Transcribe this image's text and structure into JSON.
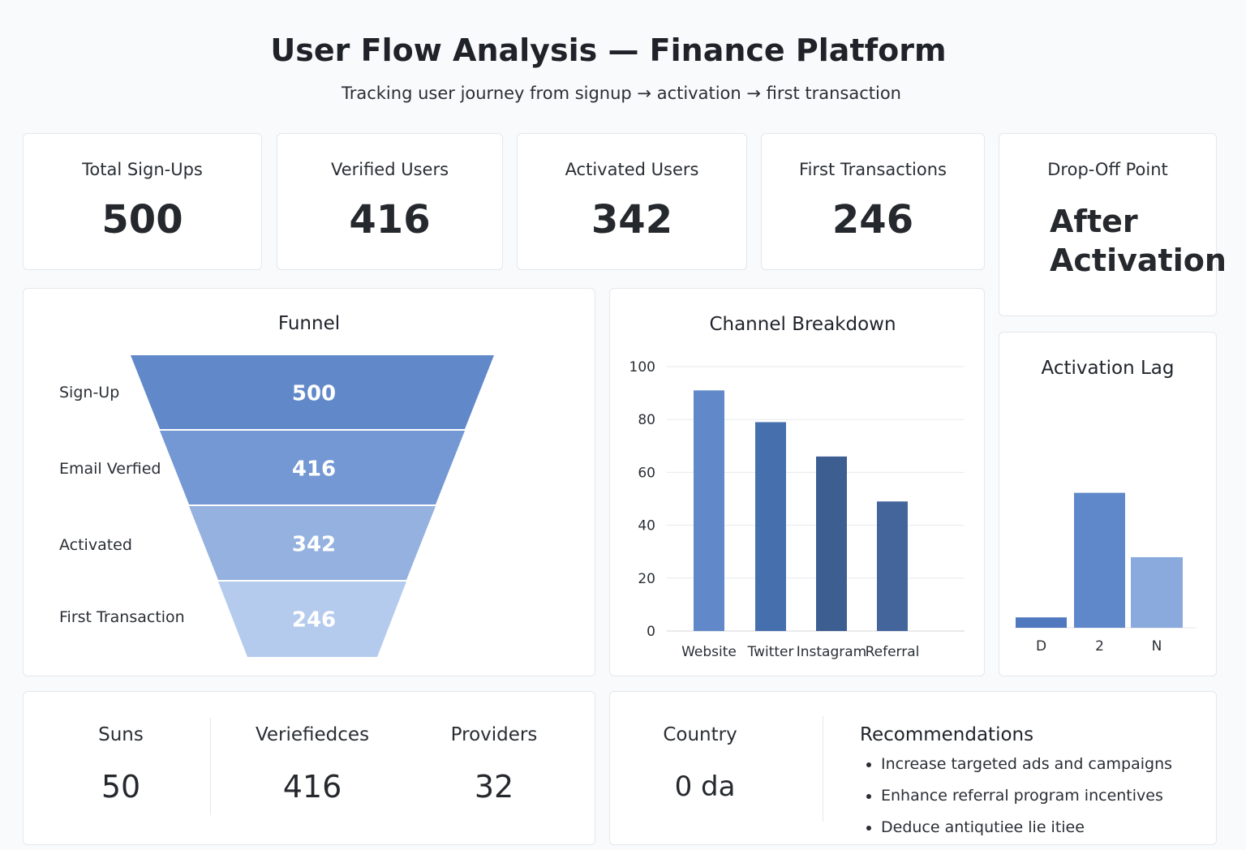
{
  "header": {
    "title": "User Flow Analysis — Finance Platform",
    "subtitle": "Tracking user journey from signup → activation → first transaction"
  },
  "kpis": [
    {
      "label": "Total Sign-Ups",
      "value": "500"
    },
    {
      "label": "Verified Users",
      "value": "416"
    },
    {
      "label": "Activated Users",
      "value": "342"
    },
    {
      "label": "First Transactions",
      "value": "246"
    }
  ],
  "dropoff": {
    "label": "Drop-Off Point",
    "value_line1": "After",
    "value_line2": "Activation"
  },
  "funnel": {
    "title": "Funnel"
  },
  "channel": {
    "title": "Channel Breakdown"
  },
  "lag": {
    "title": "Activation Lag"
  },
  "summary": [
    {
      "label": "Suns",
      "value": "50"
    },
    {
      "label": "Veriefiedces",
      "value": "416"
    },
    {
      "label": "Providers",
      "value": "32"
    }
  ],
  "country": {
    "label": "Country",
    "value": "0 da"
  },
  "recommendations": {
    "title": "Recommendations",
    "items": [
      "Increase targeted ads and campaigns",
      "Enhance referral program incentives",
      "Deduce antiqutiee lie itiee"
    ]
  },
  "colors": {
    "funnel": [
      "#6189c9",
      "#7398d3",
      "#94b1e0",
      "#b5cbee"
    ],
    "channel": [
      "#6189c9",
      "#4670ad",
      "#3d5e91",
      "#44659c"
    ],
    "lag": [
      "#4f78be",
      "#5f88cb",
      "#8aa9dc"
    ]
  },
  "chart_data": [
    {
      "type": "bar",
      "title": "Funnel",
      "categories": [
        "Sign-Up",
        "Email Verfied",
        "Activated",
        "First Transaction"
      ],
      "values": [
        500,
        416,
        342,
        246
      ]
    },
    {
      "type": "bar",
      "title": "Channel Breakdown",
      "categories": [
        "Website",
        "Twitter",
        "Instagram",
        "Referral"
      ],
      "values": [
        91,
        79,
        66,
        49
      ],
      "yticks": [
        0,
        20,
        40,
        60,
        80,
        100
      ],
      "ylim": [
        0,
        100
      ],
      "grid": true
    },
    {
      "type": "bar",
      "title": "Activation Lag",
      "categories": [
        "D",
        "2",
        "N"
      ],
      "values": [
        5,
        65,
        34
      ],
      "ylim": [
        0,
        100
      ]
    }
  ]
}
